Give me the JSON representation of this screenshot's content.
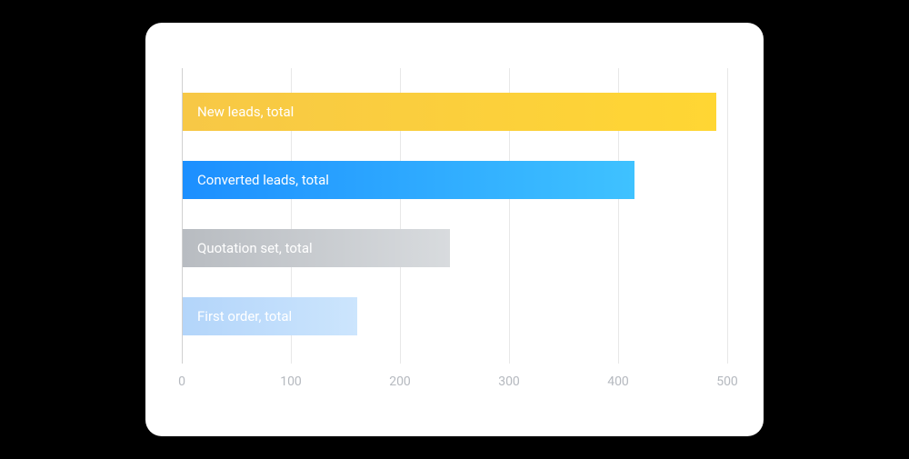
{
  "chart_data": {
    "type": "bar",
    "orientation": "horizontal",
    "categories": [
      "New leads, total",
      "Converted leads, total",
      "Quotation set, total",
      "First order, total"
    ],
    "values": [
      490,
      415,
      245,
      160
    ],
    "xlabel": "",
    "ylabel": "",
    "xlim": [
      0,
      500
    ],
    "x_ticks": [
      0,
      100,
      200,
      300,
      400,
      500
    ],
    "colors": {
      "bar0_start": "#f7c846",
      "bar0_end": "#ffd633",
      "bar1_start": "#1c8fff",
      "bar1_end": "#3fc2ff",
      "bar2_start": "#b8bcc1",
      "bar2_end": "#d8dbde",
      "bar3_start": "#b3d5fa",
      "bar3_end": "#cce5fd"
    }
  },
  "bars": {
    "label0": "New leads, total",
    "label1": "Converted leads, total",
    "label2": "Quotation set, total",
    "label3": "First order, total"
  },
  "ticks": {
    "t0": "0",
    "t1": "100",
    "t2": "200",
    "t3": "300",
    "t4": "400",
    "t5": "500"
  }
}
